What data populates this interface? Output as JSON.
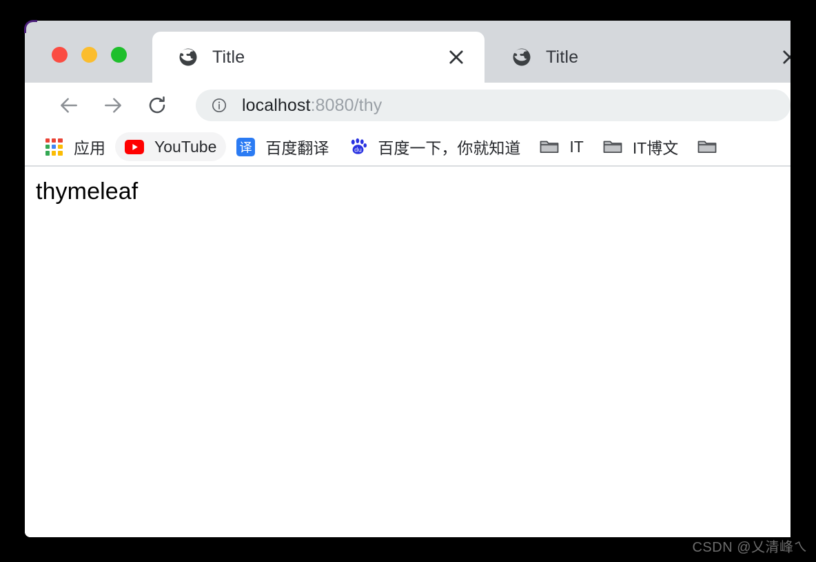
{
  "window": {
    "traffic_lights": [
      {
        "name": "close",
        "color": "#fb4c42"
      },
      {
        "name": "minimize",
        "color": "#fbbd2e"
      },
      {
        "name": "maximize",
        "color": "#1fbf2c"
      }
    ]
  },
  "tabs": [
    {
      "title": "Title",
      "favicon": "globe-icon",
      "active": true,
      "close_label": "✕"
    },
    {
      "title": "Title",
      "favicon": "globe-icon",
      "active": false,
      "close_label": "✕"
    }
  ],
  "toolbar": {
    "back_icon": "arrow-left-icon",
    "forward_icon": "arrow-right-icon",
    "reload_icon": "reload-icon",
    "site_info_icon": "info-circle-icon",
    "url_host": "localhost",
    "url_rest": ":8080/thy",
    "url_full": "localhost:8080/thy"
  },
  "bookmarks": [
    {
      "label": "应用",
      "icon": "apps-grid-icon",
      "hovered": false
    },
    {
      "label": "YouTube",
      "icon": "youtube-icon",
      "hovered": true
    },
    {
      "label": "百度翻译",
      "icon": "baidu-translate-icon",
      "hovered": false
    },
    {
      "label": "百度一下，你就知道",
      "icon": "baidu-paw-icon",
      "hovered": false
    },
    {
      "label": "IT",
      "icon": "folder-icon",
      "hovered": false
    },
    {
      "label": "IT博文",
      "icon": "folder-icon",
      "hovered": false
    },
    {
      "label": "",
      "icon": "folder-icon",
      "hovered": false
    }
  ],
  "page": {
    "heading": "thymeleaf"
  },
  "watermark": {
    "text": "CSDN @乂清峰ㄟ"
  },
  "colors": {
    "tabstrip_bg": "#d5d8dc",
    "active_tab_bg": "#ffffff",
    "omnibox_bg": "#eceff0",
    "page_bg": "#ffffff",
    "backdrop": "#000000",
    "youtube_red": "#ff0000",
    "baidu_blue": "#2932e1",
    "translate_blue": "#2b7bf3"
  }
}
